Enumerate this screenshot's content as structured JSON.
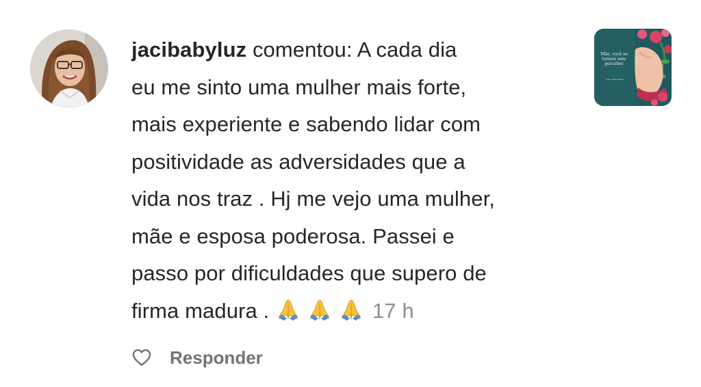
{
  "comment": {
    "username": "jacibabyluz",
    "action": "comentou:",
    "text_lines": [
      "A cada dia",
      "eu me sinto uma mulher mais forte,",
      "mais experiente e sabendo lidar com",
      "positividade as adversidades que a",
      "vida nos traz . Hj me vejo uma mulher,",
      "mãe e esposa poderosa. Passei e",
      "passo por dificuldades que supero de",
      "firma madura ."
    ],
    "emojis": [
      "🙏",
      "🙏",
      "🙏"
    ],
    "time": "17 h"
  },
  "actions": {
    "like_icon": "heart-outline-icon",
    "reply_label": "Responder"
  },
  "post_thumbnail": {
    "text_main": "Mãe, você se tornou sem perceber",
    "text_sub": "Vida e Maternidade"
  },
  "colors": {
    "text": "#262626",
    "secondary_text": "#8e8e8e",
    "reply_text": "#737373",
    "thumb_background": "#1f5a5e"
  }
}
